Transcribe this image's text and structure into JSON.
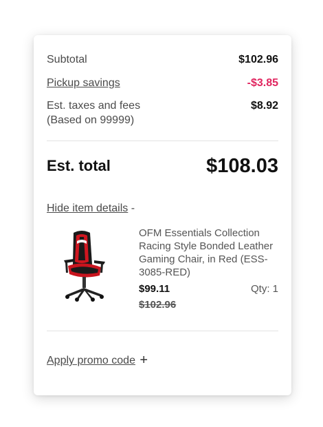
{
  "summary": {
    "subtotal_label": "Subtotal",
    "subtotal_value": "$102.96",
    "pickup_savings_label": "Pickup savings",
    "pickup_savings_value": "-$3.85",
    "taxes_label": "Est. taxes and fees",
    "taxes_sublabel": "(Based on 99999)",
    "taxes_value": "$8.92",
    "total_label": "Est. total",
    "total_value": "$108.03"
  },
  "details": {
    "toggle_label": "Hide item details",
    "toggle_symbol": "-"
  },
  "item": {
    "name": "OFM Essentials Collection Racing Style Bonded Leather Gaming Chair, in Red (ESS-3085-RED)",
    "price": "$99.11",
    "original_price": "$102.96",
    "qty": "Qty: 1",
    "image_icon": "gaming-chair-image"
  },
  "promo": {
    "label": "Apply promo code",
    "symbol": "+"
  },
  "colors": {
    "savings": "#e0245e",
    "text": "#111111",
    "muted": "#4a4a4a"
  }
}
